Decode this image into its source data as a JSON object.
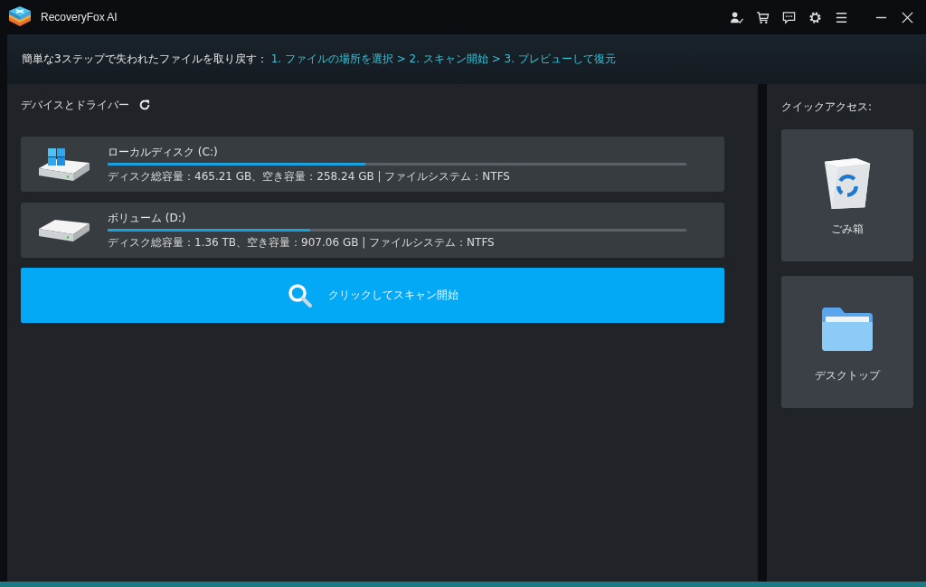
{
  "window": {
    "title": "RecoveryFox AI"
  },
  "banner": {
    "intro": "簡単な3ステップで失われたファイルを取り戻す：",
    "steps": "1. ファイルの場所を選択 > 2. スキャン開始 > 3. プレビューして復元"
  },
  "devices": {
    "title": "デバイスとドライバー",
    "drives": [
      {
        "kind": "system",
        "name": "ローカルディスク (C:)",
        "level": 0.445,
        "details": "ディスク総容量：465.21 GB、空き容量：258.24 GB | ファイルシステム：NTFS"
      },
      {
        "kind": "plain",
        "name": "ボリューム (D:)",
        "level": 0.35,
        "details": "ディスク総容量：1.36 TB、空き容量：907.06 GB | ファイルシステム：NTFS"
      }
    ],
    "scan_button": "クリックしてスキャン開始"
  },
  "quick_access": {
    "title": "クイックアクセス:",
    "items": [
      {
        "kind": "trash",
        "label": "ごみ箱"
      },
      {
        "kind": "folder",
        "label": "デスクトップ"
      }
    ]
  }
}
